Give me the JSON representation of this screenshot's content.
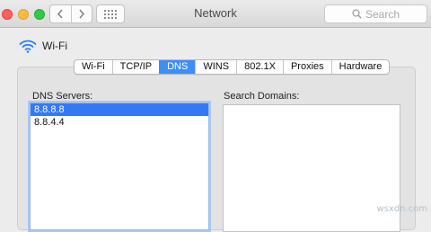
{
  "window": {
    "title": "Network",
    "search_placeholder": "Search"
  },
  "network": {
    "name": "Wi-Fi",
    "icon": "wifi-icon"
  },
  "tabs": [
    {
      "label": "Wi-Fi",
      "active": false
    },
    {
      "label": "TCP/IP",
      "active": false
    },
    {
      "label": "DNS",
      "active": true
    },
    {
      "label": "WINS",
      "active": false
    },
    {
      "label": "802.1X",
      "active": false
    },
    {
      "label": "Proxies",
      "active": false
    },
    {
      "label": "Hardware",
      "active": false
    }
  ],
  "dns_servers": {
    "label": "DNS Servers:",
    "items": [
      "8.8.8.8",
      "8.8.4.4"
    ],
    "selected_index": 0
  },
  "search_domains": {
    "label": "Search Domains:",
    "items": []
  },
  "watermark": "wsxdn.com",
  "colors": {
    "accent": "#3d8ef5",
    "selection": "#3478f6",
    "close": "#fc605c",
    "minimize": "#fdbc40",
    "zoom": "#34c84a",
    "wifi": "#2f7ef3"
  }
}
